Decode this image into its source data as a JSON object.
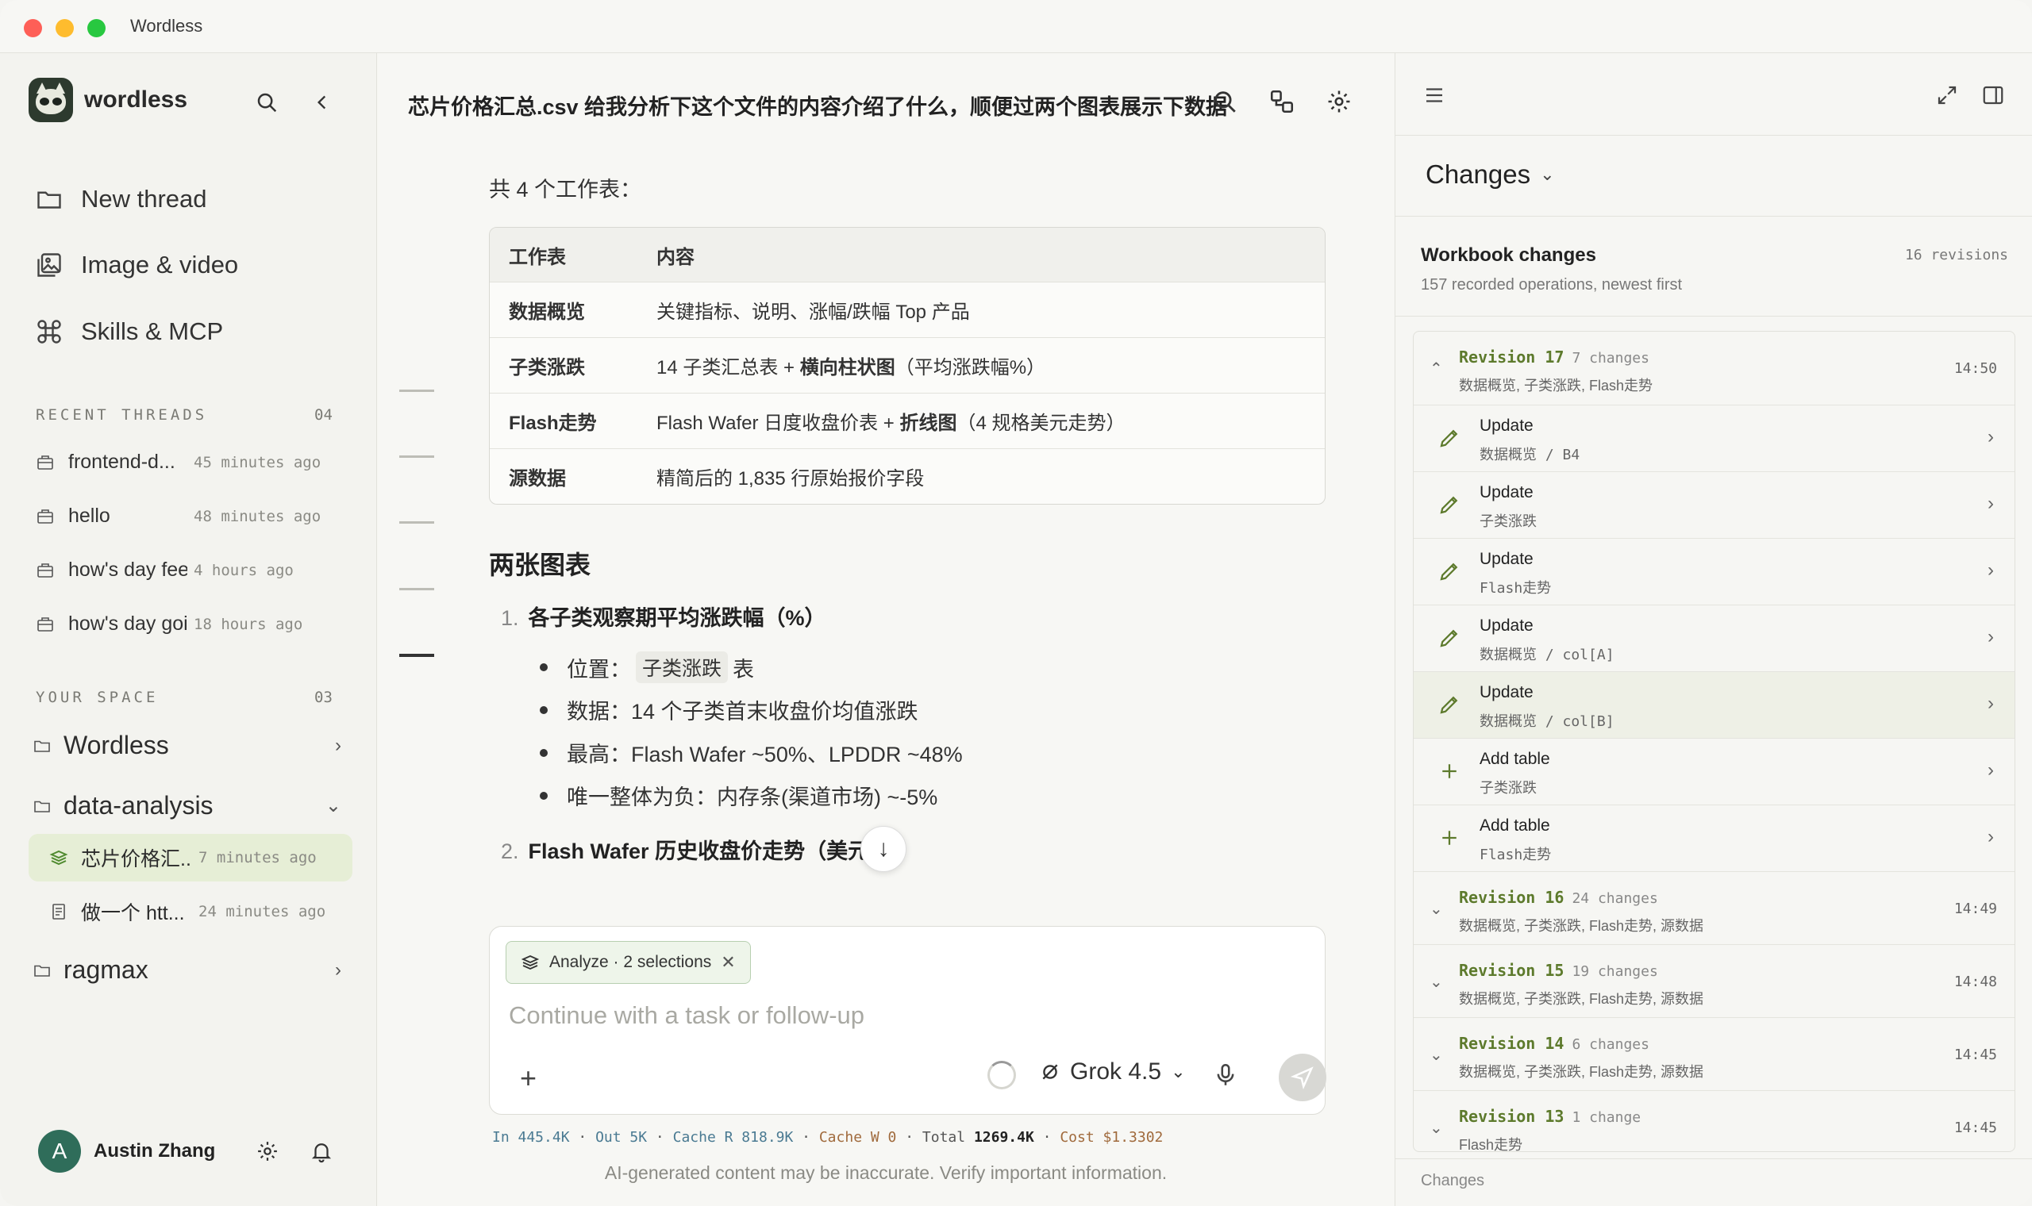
{
  "window": {
    "title": "Wordless"
  },
  "sidebar": {
    "brand": "wordless",
    "nav": [
      {
        "label": "New thread"
      },
      {
        "label": "Image & video"
      },
      {
        "label": "Skills & MCP"
      }
    ],
    "recent": {
      "label": "RECENT THREADS",
      "count": "04",
      "items": [
        {
          "title": "frontend-d...",
          "time": "45 minutes ago"
        },
        {
          "title": "hello",
          "time": "48 minutes ago"
        },
        {
          "title": "how's day feeli...",
          "time": "4 hours ago"
        },
        {
          "title": "how's day goi...",
          "time": "18 hours ago"
        }
      ]
    },
    "space": {
      "label": "YOUR SPACE",
      "count": "03",
      "folders": [
        {
          "name": "Wordless"
        },
        {
          "name": "data-analysis"
        },
        {
          "name": "ragmax"
        }
      ],
      "subitems": [
        {
          "title": "芯片价格汇...",
          "time": "7 minutes ago"
        },
        {
          "title": "做一个 htt...",
          "time": "24 minutes ago"
        }
      ]
    },
    "user": {
      "initial": "A",
      "name": "Austin Zhang"
    }
  },
  "main": {
    "title": "芯片价格汇总.csv 给我分析下这个文件的内容介绍了什么，顺便过两个图表展示下数据",
    "intro": "共 4 个工作表：",
    "table": {
      "headers": [
        "工作表",
        "内容"
      ],
      "rows": [
        {
          "c1": "数据概览",
          "c2": "关键指标、说明、涨幅/跌幅 Top 产品"
        },
        {
          "c1": "子类涨跌",
          "c2a": "14 子类汇总表 + ",
          "c2b": "横向柱状图",
          "c2c": "（平均涨跌幅%）"
        },
        {
          "c1": "Flash走势",
          "c2a": "Flash Wafer 日度收盘价表 + ",
          "c2b": "折线图",
          "c2c": "（4 规格美元走势）"
        },
        {
          "c1": "源数据",
          "c2": "精简后的 1,835 行原始报价字段"
        }
      ]
    },
    "heading": "两张图表",
    "list1": {
      "num": "1.",
      "title": "各子类观察期平均涨跌幅（%）",
      "bullets": {
        "pos_label": "位置：",
        "pos_code": "子类涨跌",
        "pos_suffix": "表",
        "data": "数据：14 个子类首末收盘价均值涨跌",
        "high": "最高：Flash Wafer ~50%、LPDDR ~48%",
        "neg": "唯一整体为负：内存条(渠道市场) ~-5%"
      }
    },
    "list2": {
      "num": "2.",
      "title": "Flash Wafer 历史收盘价走势（美元"
    },
    "composer": {
      "chip": "Analyze · 2 selections",
      "placeholder": "Continue with a task or follow-up",
      "model": "Grok 4.5"
    },
    "stats": {
      "in": "In 445.4K",
      "out": "Out 5K",
      "cache_r": "Cache R 818.9K",
      "cache_w": "Cache W 0",
      "total_label": "Total",
      "total": "1269.4K",
      "cost_label": "Cost",
      "cost": "$1.3302"
    },
    "disclaimer": "AI-generated content may be inaccurate. Verify important information."
  },
  "panel": {
    "title": "Changes",
    "wc_title": "Workbook changes",
    "wc_sub": "157 recorded operations, newest first",
    "revisions": "16 revisions",
    "rev17": {
      "name": "Revision 17",
      "changes": "7 changes",
      "sheets": "数据概览, 子类涨跌, Flash走势",
      "time": "14:50"
    },
    "ops": [
      {
        "type": "Update",
        "sub": "数据概览 / B4"
      },
      {
        "type": "Update",
        "sub": "子类涨跌"
      },
      {
        "type": "Update",
        "sub": "Flash走势"
      },
      {
        "type": "Update",
        "sub": "数据概览 / col[A]"
      },
      {
        "type": "Update",
        "sub": "数据概览 / col[B]"
      },
      {
        "type": "Add table",
        "sub": "子类涨跌"
      },
      {
        "type": "Add table",
        "sub": "Flash走势"
      }
    ],
    "revs": [
      {
        "name": "Revision 16",
        "changes": "24 changes",
        "sheets": "数据概览, 子类涨跌, Flash走势, 源数据",
        "time": "14:49"
      },
      {
        "name": "Revision 15",
        "changes": "19 changes",
        "sheets": "数据概览, 子类涨跌, Flash走势, 源数据",
        "time": "14:48"
      },
      {
        "name": "Revision 14",
        "changes": "6 changes",
        "sheets": "数据概览, 子类涨跌, Flash走势, 源数据",
        "time": "14:45"
      },
      {
        "name": "Revision 13",
        "changes": "1 change",
        "sheets": "Flash走势",
        "time": "14:45"
      }
    ],
    "footer": "Changes"
  }
}
